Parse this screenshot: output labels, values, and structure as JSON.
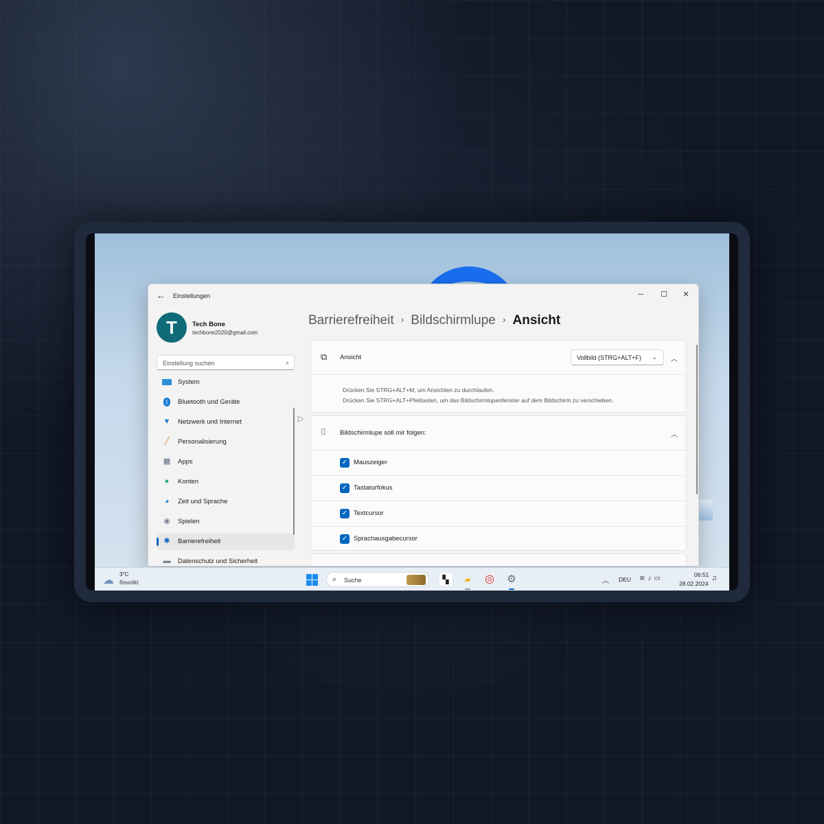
{
  "window": {
    "title": "Einstellungen",
    "minimize_glyph": "─",
    "maximize_glyph": "☐",
    "close_glyph": "✕"
  },
  "user": {
    "initial": "T",
    "name": "Tech Bone",
    "email": "techbone2020@gmail.com"
  },
  "search": {
    "placeholder": "Einstellung suchen"
  },
  "sidebar": {
    "items": [
      {
        "label": "System",
        "icon": "monitor-icon"
      },
      {
        "label": "Bluetooth und Geräte",
        "icon": "bluetooth-icon"
      },
      {
        "label": "Netzwerk und Internet",
        "icon": "wifi-icon"
      },
      {
        "label": "Personalisierung",
        "icon": "brush-icon"
      },
      {
        "label": "Apps",
        "icon": "apps-icon"
      },
      {
        "label": "Konten",
        "icon": "person-icon"
      },
      {
        "label": "Zeit und Sprache",
        "icon": "globe-clock-icon"
      },
      {
        "label": "Spielen",
        "icon": "gamepad-icon"
      },
      {
        "label": "Barrierefreiheit",
        "icon": "accessibility-icon",
        "active": true
      },
      {
        "label": "Datenschutz und Sicherheit",
        "icon": "shield-icon"
      }
    ]
  },
  "breadcrumb": {
    "items": [
      "Barrierefreiheit",
      "Bildschirmlupe"
    ],
    "current": "Ansicht"
  },
  "view_card": {
    "label": "Ansicht",
    "dropdown_value": "Vollbild (STRG+ALT+F)",
    "desc_line1": "Drücken Sie STRG+ALT+M, um Ansichten zu durchlaufen.",
    "desc_line2": "Drücken Sie STRG+ALT+Pfeiltasten, um das Bildschirmlupenfenster auf dem Bildschirm zu verschieben."
  },
  "follow_card": {
    "label": "Bildschirmlupe soll mir folgen:",
    "options": [
      {
        "label": "Mauszeiger",
        "checked": true
      },
      {
        "label": "Tastaturfokus",
        "checked": true
      },
      {
        "label": "Textcursor",
        "checked": true
      },
      {
        "label": "Sprachausgabecursor",
        "checked": true
      }
    ]
  },
  "taskbar": {
    "weather_temp": "3°C",
    "weather_desc": "Bewölkt",
    "search_label": "Suche",
    "lang": "DEU",
    "time": "06:51",
    "date": "28.02.2024"
  },
  "colors": {
    "accent": "#0067c0",
    "avatar": "#0f6b77"
  }
}
